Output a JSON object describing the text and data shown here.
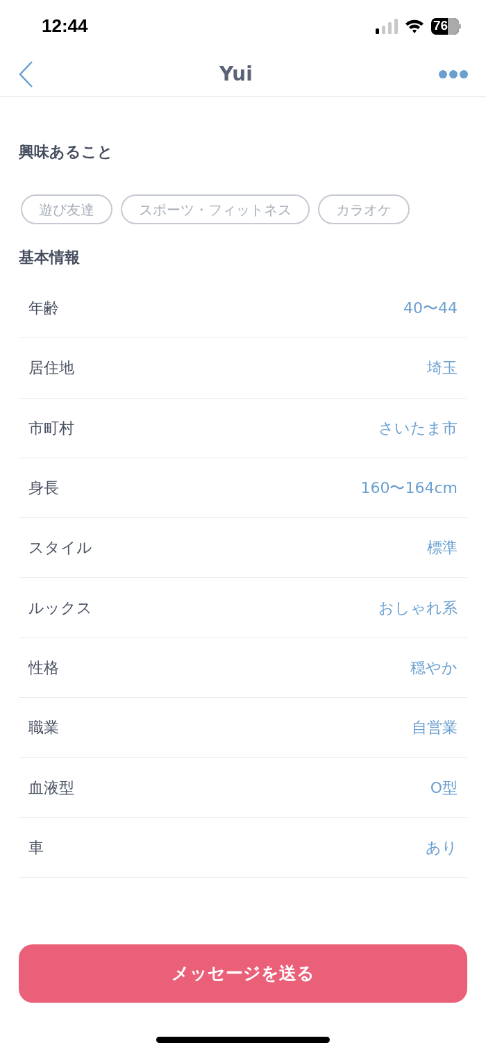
{
  "status_bar": {
    "time": "12:44",
    "battery": "76"
  },
  "nav": {
    "title": "Yui"
  },
  "interests": {
    "title": "興味あること",
    "tags": [
      "遊び友達",
      "スポーツ・フィットネス",
      "カラオケ"
    ]
  },
  "basic_info": {
    "title": "基本情報",
    "rows": [
      {
        "label": "年齢",
        "value": "40〜44"
      },
      {
        "label": "居住地",
        "value": "埼玉"
      },
      {
        "label": "市町村",
        "value": "さいたま市"
      },
      {
        "label": "身長",
        "value": "160〜164cm"
      },
      {
        "label": "スタイル",
        "value": "標準"
      },
      {
        "label": "ルックス",
        "value": "おしゃれ系"
      },
      {
        "label": "性格",
        "value": "穏やか"
      },
      {
        "label": "職業",
        "value": "自営業"
      },
      {
        "label": "血液型",
        "value": "O型"
      },
      {
        "label": "車",
        "value": "あり"
      }
    ]
  },
  "send_button": "メッセージを送る"
}
